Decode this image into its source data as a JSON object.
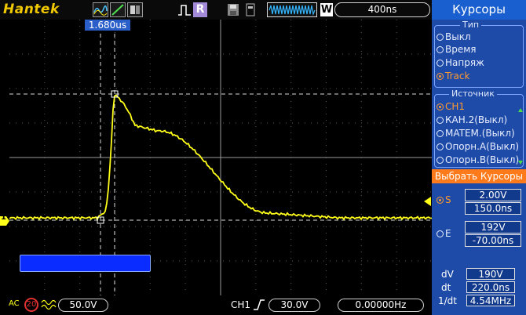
{
  "top_bar": {
    "logo": "Hantek",
    "wave_mode_icons": [
      "normal-wave-icon",
      "vector-wave-icon",
      "persist-wave-icon"
    ],
    "trigger_mode_icons": [
      "pulse-icon",
      "R",
      "save-icon",
      "usb-icon"
    ],
    "memory_depth_icon": "memory-wave-icon",
    "window_label": "W",
    "timebase": "400ns"
  },
  "screen": {
    "time_cursor_readout": "1.680us",
    "channel1_marker": "1",
    "blank_box_text": ""
  },
  "bottom_bar": {
    "coupling_label": "AC",
    "bw_limit_label": "20",
    "ch1_volts_div": "50.0V",
    "trigger_source": "CH1",
    "trigger_level": "30.0V",
    "frequency": "0.00000Hz"
  },
  "menu": {
    "title": "Курсоры",
    "type_group": {
      "label": "Тип",
      "options": [
        "Выкл",
        "Время",
        "Напряж",
        "Track"
      ],
      "selected": "Track"
    },
    "source_group": {
      "label": "Источник",
      "options": [
        "CH1",
        "КАН.2(Выкл)",
        "MATEM.(Выкл)",
        "Опорн.А(Выкл)",
        "Опорн.В(Выкл)"
      ],
      "selected": "CH1"
    },
    "select_cursor_label": "Выбрать Курсоры",
    "cursor_s": {
      "label": "S",
      "voltage": "2.00V",
      "time": "150.0ns"
    },
    "cursor_e": {
      "label": "E",
      "voltage": "192V",
      "time": "-70.00ns"
    },
    "measurements": {
      "dv_label": "dV",
      "dv": "190V",
      "dt_label": "dt",
      "dt": "220.0ns",
      "inv_dt_label": "1/dt",
      "inv_dt": "4.54MHz"
    }
  },
  "colors": {
    "trace": "#ffff1a",
    "menu_bg": "#1e4aa8",
    "selected_option": "#ff9a30",
    "logo": "#f0c800"
  }
}
